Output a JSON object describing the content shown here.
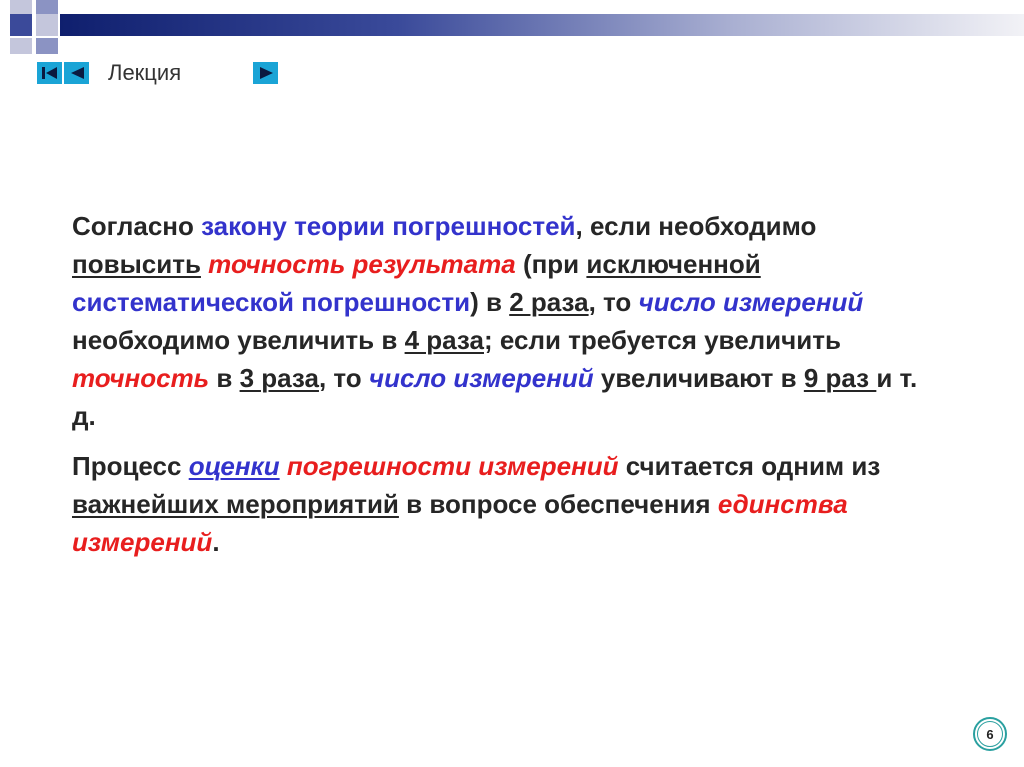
{
  "header": {
    "title": "Лекция"
  },
  "nav": {
    "first_icon": "first-page-icon",
    "prev_icon": "previous-page-icon",
    "next_icon": "next-page-icon",
    "button_color": "#1aa4d6"
  },
  "paragraph1": {
    "s1": "Согласно ",
    "s2": "закону теории погрешностей",
    "s3": ", если необходимо ",
    "s4": "повысить",
    "s5": " ",
    "s6": "точность результата",
    "s7": " (при ",
    "s8": "исключенной",
    "s9": " ",
    "s10": "систематической погрешности",
    "s11": ") в ",
    "s12": "2 раза",
    "s13": ", то ",
    "s14": "число измерений",
    "s15": " необходимо увеличить в ",
    "s16": "4 раза",
    "s17": "; если требуется увеличить ",
    "s18": "точность",
    "s19": " в ",
    "s20": "3 раза",
    "s21": ", то ",
    "s22": "число измерений",
    "s23": " увеличивают в ",
    "s24": "9 раз ",
    "s25": "и т. д."
  },
  "paragraph2": {
    "s1": "Процесс ",
    "s2": "оценки",
    "s3": " ",
    "s4": "погрешности измерений",
    "s5": " считается одним из ",
    "s6": "важнейших мероприятий",
    "s7": " в вопросе обеспечения ",
    "s8": "единства измерений",
    "s9": "."
  },
  "footer": {
    "page_number": "6"
  },
  "colors": {
    "blue_term": "#3333cc",
    "red_term": "#e81e1e",
    "body_text": "#262626"
  }
}
